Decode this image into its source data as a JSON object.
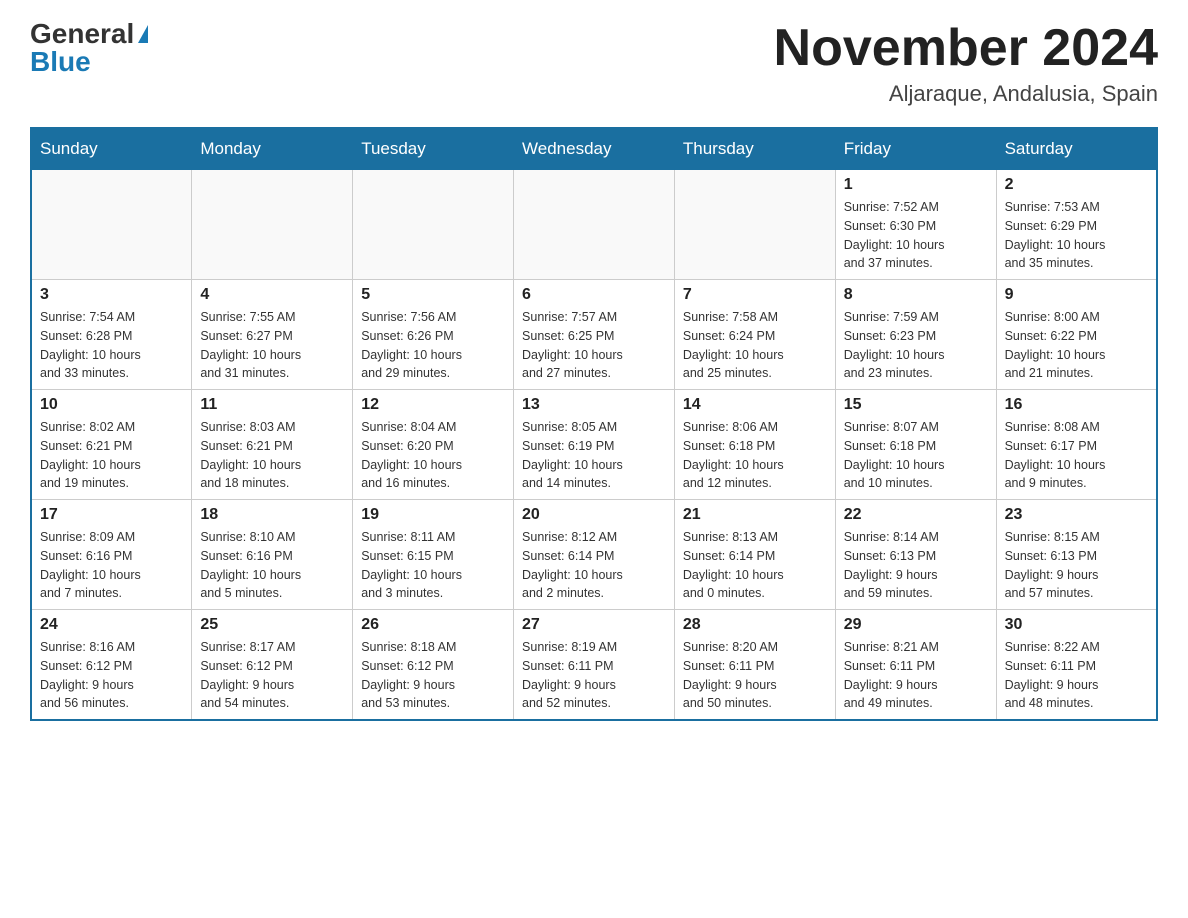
{
  "header": {
    "logo_general": "General",
    "logo_blue": "Blue",
    "title": "November 2024",
    "subtitle": "Aljaraque, Andalusia, Spain"
  },
  "days_of_week": [
    "Sunday",
    "Monday",
    "Tuesday",
    "Wednesday",
    "Thursday",
    "Friday",
    "Saturday"
  ],
  "weeks": [
    [
      {
        "day": "",
        "info": ""
      },
      {
        "day": "",
        "info": ""
      },
      {
        "day": "",
        "info": ""
      },
      {
        "day": "",
        "info": ""
      },
      {
        "day": "",
        "info": ""
      },
      {
        "day": "1",
        "info": "Sunrise: 7:52 AM\nSunset: 6:30 PM\nDaylight: 10 hours\nand 37 minutes."
      },
      {
        "day": "2",
        "info": "Sunrise: 7:53 AM\nSunset: 6:29 PM\nDaylight: 10 hours\nand 35 minutes."
      }
    ],
    [
      {
        "day": "3",
        "info": "Sunrise: 7:54 AM\nSunset: 6:28 PM\nDaylight: 10 hours\nand 33 minutes."
      },
      {
        "day": "4",
        "info": "Sunrise: 7:55 AM\nSunset: 6:27 PM\nDaylight: 10 hours\nand 31 minutes."
      },
      {
        "day": "5",
        "info": "Sunrise: 7:56 AM\nSunset: 6:26 PM\nDaylight: 10 hours\nand 29 minutes."
      },
      {
        "day": "6",
        "info": "Sunrise: 7:57 AM\nSunset: 6:25 PM\nDaylight: 10 hours\nand 27 minutes."
      },
      {
        "day": "7",
        "info": "Sunrise: 7:58 AM\nSunset: 6:24 PM\nDaylight: 10 hours\nand 25 minutes."
      },
      {
        "day": "8",
        "info": "Sunrise: 7:59 AM\nSunset: 6:23 PM\nDaylight: 10 hours\nand 23 minutes."
      },
      {
        "day": "9",
        "info": "Sunrise: 8:00 AM\nSunset: 6:22 PM\nDaylight: 10 hours\nand 21 minutes."
      }
    ],
    [
      {
        "day": "10",
        "info": "Sunrise: 8:02 AM\nSunset: 6:21 PM\nDaylight: 10 hours\nand 19 minutes."
      },
      {
        "day": "11",
        "info": "Sunrise: 8:03 AM\nSunset: 6:21 PM\nDaylight: 10 hours\nand 18 minutes."
      },
      {
        "day": "12",
        "info": "Sunrise: 8:04 AM\nSunset: 6:20 PM\nDaylight: 10 hours\nand 16 minutes."
      },
      {
        "day": "13",
        "info": "Sunrise: 8:05 AM\nSunset: 6:19 PM\nDaylight: 10 hours\nand 14 minutes."
      },
      {
        "day": "14",
        "info": "Sunrise: 8:06 AM\nSunset: 6:18 PM\nDaylight: 10 hours\nand 12 minutes."
      },
      {
        "day": "15",
        "info": "Sunrise: 8:07 AM\nSunset: 6:18 PM\nDaylight: 10 hours\nand 10 minutes."
      },
      {
        "day": "16",
        "info": "Sunrise: 8:08 AM\nSunset: 6:17 PM\nDaylight: 10 hours\nand 9 minutes."
      }
    ],
    [
      {
        "day": "17",
        "info": "Sunrise: 8:09 AM\nSunset: 6:16 PM\nDaylight: 10 hours\nand 7 minutes."
      },
      {
        "day": "18",
        "info": "Sunrise: 8:10 AM\nSunset: 6:16 PM\nDaylight: 10 hours\nand 5 minutes."
      },
      {
        "day": "19",
        "info": "Sunrise: 8:11 AM\nSunset: 6:15 PM\nDaylight: 10 hours\nand 3 minutes."
      },
      {
        "day": "20",
        "info": "Sunrise: 8:12 AM\nSunset: 6:14 PM\nDaylight: 10 hours\nand 2 minutes."
      },
      {
        "day": "21",
        "info": "Sunrise: 8:13 AM\nSunset: 6:14 PM\nDaylight: 10 hours\nand 0 minutes."
      },
      {
        "day": "22",
        "info": "Sunrise: 8:14 AM\nSunset: 6:13 PM\nDaylight: 9 hours\nand 59 minutes."
      },
      {
        "day": "23",
        "info": "Sunrise: 8:15 AM\nSunset: 6:13 PM\nDaylight: 9 hours\nand 57 minutes."
      }
    ],
    [
      {
        "day": "24",
        "info": "Sunrise: 8:16 AM\nSunset: 6:12 PM\nDaylight: 9 hours\nand 56 minutes."
      },
      {
        "day": "25",
        "info": "Sunrise: 8:17 AM\nSunset: 6:12 PM\nDaylight: 9 hours\nand 54 minutes."
      },
      {
        "day": "26",
        "info": "Sunrise: 8:18 AM\nSunset: 6:12 PM\nDaylight: 9 hours\nand 53 minutes."
      },
      {
        "day": "27",
        "info": "Sunrise: 8:19 AM\nSunset: 6:11 PM\nDaylight: 9 hours\nand 52 minutes."
      },
      {
        "day": "28",
        "info": "Sunrise: 8:20 AM\nSunset: 6:11 PM\nDaylight: 9 hours\nand 50 minutes."
      },
      {
        "day": "29",
        "info": "Sunrise: 8:21 AM\nSunset: 6:11 PM\nDaylight: 9 hours\nand 49 minutes."
      },
      {
        "day": "30",
        "info": "Sunrise: 8:22 AM\nSunset: 6:11 PM\nDaylight: 9 hours\nand 48 minutes."
      }
    ]
  ]
}
